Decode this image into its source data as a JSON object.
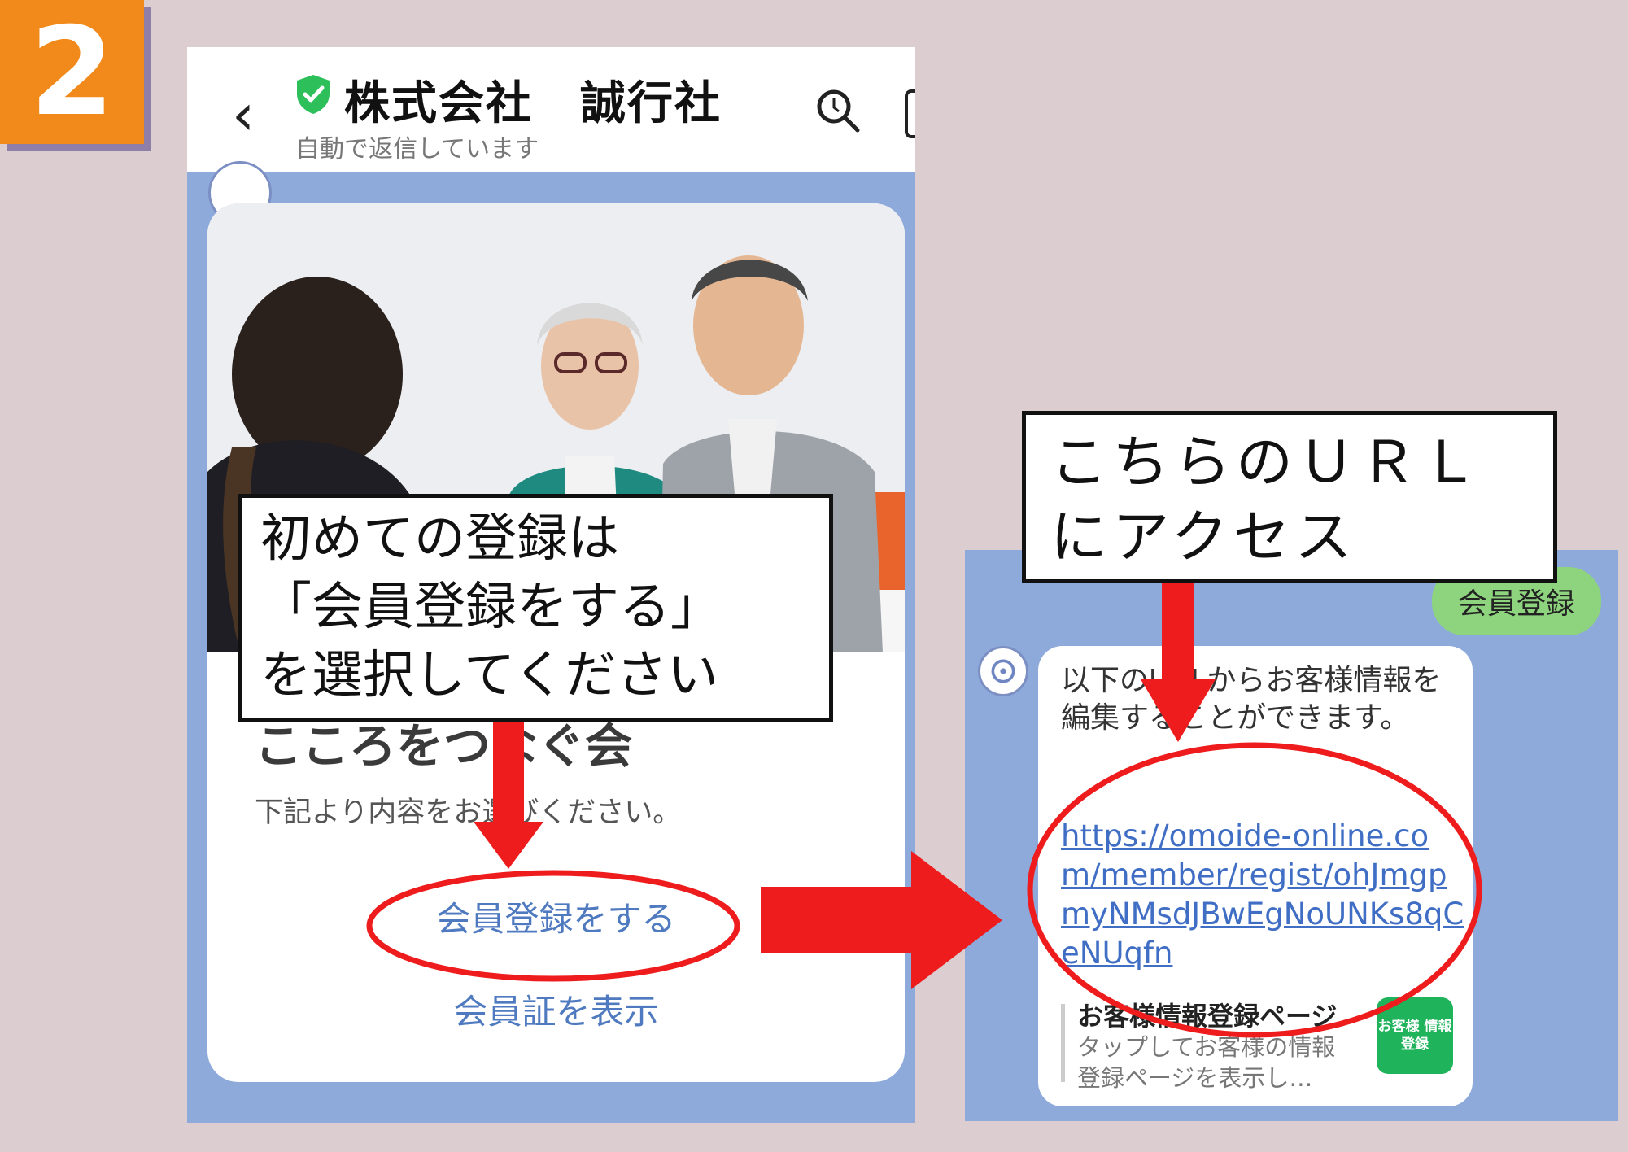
{
  "step_number": "2",
  "chat_header": {
    "account_name": "株式会社　誠行社",
    "status": "自動で返信しています"
  },
  "card": {
    "title": "こころをつなぐ会",
    "description": "下記より内容をお選びください。",
    "register_button": "会員登録をする",
    "member_card_button": "会員証を表示"
  },
  "callouts": {
    "first": [
      "初めての登録は",
      "「会員登録をする」",
      "を選択してください"
    ],
    "second": [
      "こちらのＵＲＬ",
      "にアクセス"
    ]
  },
  "chat2": {
    "user_message": "会員登録",
    "reply_text": "以下のURLからお客様情報を編集することができます。",
    "reply_link": "https://omoide-online.com/member/regist/ohJmgpmyNMsdJBwEgNoUNKs8qCeNUqfn",
    "preview_title": "お客様情報登録ページ",
    "preview_description": "タップしてお客様の情報登録ページを表示し…",
    "preview_thumb": "お客様 情報登録"
  },
  "colors": {
    "background": "#dccdd1",
    "badge": "#f28a1b",
    "chat_bg": "#8eaadb",
    "annotation_red": "#ee1c1c",
    "link_blue": "#3f6ec4",
    "user_bubble": "#8ed37e"
  },
  "icons": [
    "back-arrow-icon",
    "verified-shield-icon",
    "search-icon",
    "menu-icon",
    "account-avatar-icon",
    "photo-placeholder"
  ]
}
